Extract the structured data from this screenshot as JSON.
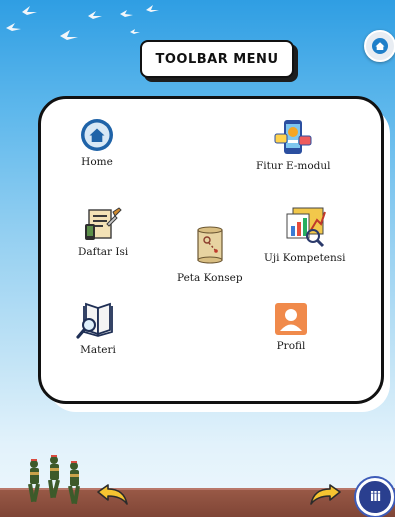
{
  "title": "TOOLBAR MENU",
  "menu": {
    "home": "Home",
    "fitur": "Fitur E-modul",
    "daftar": "Daftar Isi",
    "peta": "Peta Konsep",
    "uji": "Uji Kompetensi",
    "materi": "Materi",
    "profil": "Profil"
  },
  "bottom": {
    "grid_button": "iii"
  },
  "colors": {
    "sky_top": "#2f9ee3",
    "panel_border": "#111111",
    "ground": "#8b4f3f",
    "fab_blue": "#2a3f8f"
  }
}
